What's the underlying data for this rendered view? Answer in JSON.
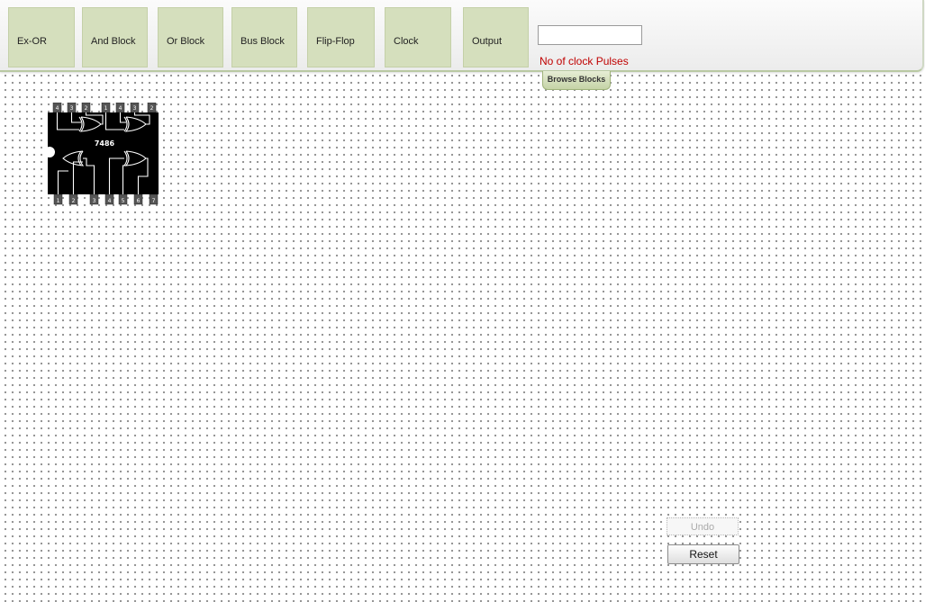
{
  "toolbar": {
    "blocks": [
      {
        "label": "Ex-OR"
      },
      {
        "label": "And Block"
      },
      {
        "label": "Or Block"
      },
      {
        "label": "Bus Block"
      },
      {
        "label": "Flip-Flop"
      },
      {
        "label": "Clock"
      },
      {
        "label": "Output"
      }
    ],
    "clock_pulses_value": "",
    "clock_pulses_label": "No of clock Pulses",
    "browse_label": "Browse Blocks"
  },
  "chip": {
    "label": "7486",
    "top_pins": [
      "4",
      "3",
      "2",
      "1",
      "4",
      "3",
      "2"
    ],
    "bottom_pins": [
      "1",
      "2",
      "3",
      "4",
      "5",
      "6",
      "7"
    ]
  },
  "controls": {
    "undo_label": "Undo",
    "reset_label": "Reset"
  },
  "colors": {
    "block_bg": "#d5dfbd",
    "warning_text": "#c00000",
    "chip_body": "#000000"
  }
}
